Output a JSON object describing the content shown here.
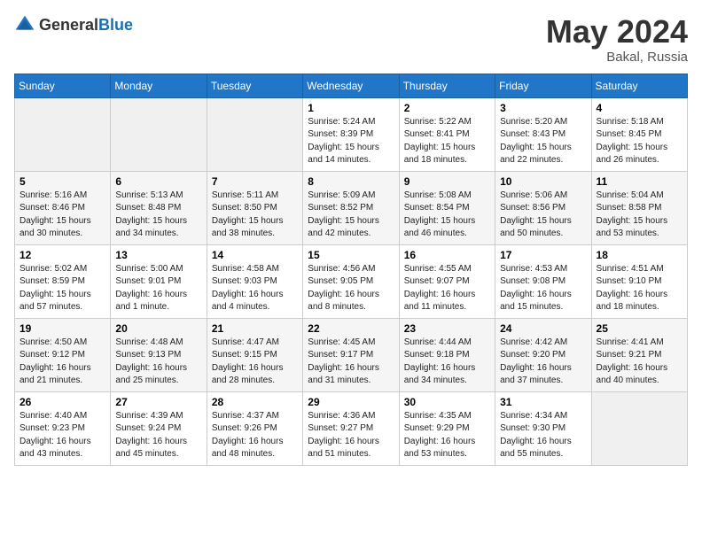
{
  "header": {
    "logo_general": "General",
    "logo_blue": "Blue",
    "month": "May 2024",
    "location": "Bakal, Russia"
  },
  "calendar": {
    "days_of_week": [
      "Sunday",
      "Monday",
      "Tuesday",
      "Wednesday",
      "Thursday",
      "Friday",
      "Saturday"
    ],
    "weeks": [
      [
        {
          "day": "",
          "info": ""
        },
        {
          "day": "",
          "info": ""
        },
        {
          "day": "",
          "info": ""
        },
        {
          "day": "1",
          "info": "Sunrise: 5:24 AM\nSunset: 8:39 PM\nDaylight: 15 hours\nand 14 minutes."
        },
        {
          "day": "2",
          "info": "Sunrise: 5:22 AM\nSunset: 8:41 PM\nDaylight: 15 hours\nand 18 minutes."
        },
        {
          "day": "3",
          "info": "Sunrise: 5:20 AM\nSunset: 8:43 PM\nDaylight: 15 hours\nand 22 minutes."
        },
        {
          "day": "4",
          "info": "Sunrise: 5:18 AM\nSunset: 8:45 PM\nDaylight: 15 hours\nand 26 minutes."
        }
      ],
      [
        {
          "day": "5",
          "info": "Sunrise: 5:16 AM\nSunset: 8:46 PM\nDaylight: 15 hours\nand 30 minutes."
        },
        {
          "day": "6",
          "info": "Sunrise: 5:13 AM\nSunset: 8:48 PM\nDaylight: 15 hours\nand 34 minutes."
        },
        {
          "day": "7",
          "info": "Sunrise: 5:11 AM\nSunset: 8:50 PM\nDaylight: 15 hours\nand 38 minutes."
        },
        {
          "day": "8",
          "info": "Sunrise: 5:09 AM\nSunset: 8:52 PM\nDaylight: 15 hours\nand 42 minutes."
        },
        {
          "day": "9",
          "info": "Sunrise: 5:08 AM\nSunset: 8:54 PM\nDaylight: 15 hours\nand 46 minutes."
        },
        {
          "day": "10",
          "info": "Sunrise: 5:06 AM\nSunset: 8:56 PM\nDaylight: 15 hours\nand 50 minutes."
        },
        {
          "day": "11",
          "info": "Sunrise: 5:04 AM\nSunset: 8:58 PM\nDaylight: 15 hours\nand 53 minutes."
        }
      ],
      [
        {
          "day": "12",
          "info": "Sunrise: 5:02 AM\nSunset: 8:59 PM\nDaylight: 15 hours\nand 57 minutes."
        },
        {
          "day": "13",
          "info": "Sunrise: 5:00 AM\nSunset: 9:01 PM\nDaylight: 16 hours\nand 1 minute."
        },
        {
          "day": "14",
          "info": "Sunrise: 4:58 AM\nSunset: 9:03 PM\nDaylight: 16 hours\nand 4 minutes."
        },
        {
          "day": "15",
          "info": "Sunrise: 4:56 AM\nSunset: 9:05 PM\nDaylight: 16 hours\nand 8 minutes."
        },
        {
          "day": "16",
          "info": "Sunrise: 4:55 AM\nSunset: 9:07 PM\nDaylight: 16 hours\nand 11 minutes."
        },
        {
          "day": "17",
          "info": "Sunrise: 4:53 AM\nSunset: 9:08 PM\nDaylight: 16 hours\nand 15 minutes."
        },
        {
          "day": "18",
          "info": "Sunrise: 4:51 AM\nSunset: 9:10 PM\nDaylight: 16 hours\nand 18 minutes."
        }
      ],
      [
        {
          "day": "19",
          "info": "Sunrise: 4:50 AM\nSunset: 9:12 PM\nDaylight: 16 hours\nand 21 minutes."
        },
        {
          "day": "20",
          "info": "Sunrise: 4:48 AM\nSunset: 9:13 PM\nDaylight: 16 hours\nand 25 minutes."
        },
        {
          "day": "21",
          "info": "Sunrise: 4:47 AM\nSunset: 9:15 PM\nDaylight: 16 hours\nand 28 minutes."
        },
        {
          "day": "22",
          "info": "Sunrise: 4:45 AM\nSunset: 9:17 PM\nDaylight: 16 hours\nand 31 minutes."
        },
        {
          "day": "23",
          "info": "Sunrise: 4:44 AM\nSunset: 9:18 PM\nDaylight: 16 hours\nand 34 minutes."
        },
        {
          "day": "24",
          "info": "Sunrise: 4:42 AM\nSunset: 9:20 PM\nDaylight: 16 hours\nand 37 minutes."
        },
        {
          "day": "25",
          "info": "Sunrise: 4:41 AM\nSunset: 9:21 PM\nDaylight: 16 hours\nand 40 minutes."
        }
      ],
      [
        {
          "day": "26",
          "info": "Sunrise: 4:40 AM\nSunset: 9:23 PM\nDaylight: 16 hours\nand 43 minutes."
        },
        {
          "day": "27",
          "info": "Sunrise: 4:39 AM\nSunset: 9:24 PM\nDaylight: 16 hours\nand 45 minutes."
        },
        {
          "day": "28",
          "info": "Sunrise: 4:37 AM\nSunset: 9:26 PM\nDaylight: 16 hours\nand 48 minutes."
        },
        {
          "day": "29",
          "info": "Sunrise: 4:36 AM\nSunset: 9:27 PM\nDaylight: 16 hours\nand 51 minutes."
        },
        {
          "day": "30",
          "info": "Sunrise: 4:35 AM\nSunset: 9:29 PM\nDaylight: 16 hours\nand 53 minutes."
        },
        {
          "day": "31",
          "info": "Sunrise: 4:34 AM\nSunset: 9:30 PM\nDaylight: 16 hours\nand 55 minutes."
        },
        {
          "day": "",
          "info": ""
        }
      ]
    ]
  }
}
